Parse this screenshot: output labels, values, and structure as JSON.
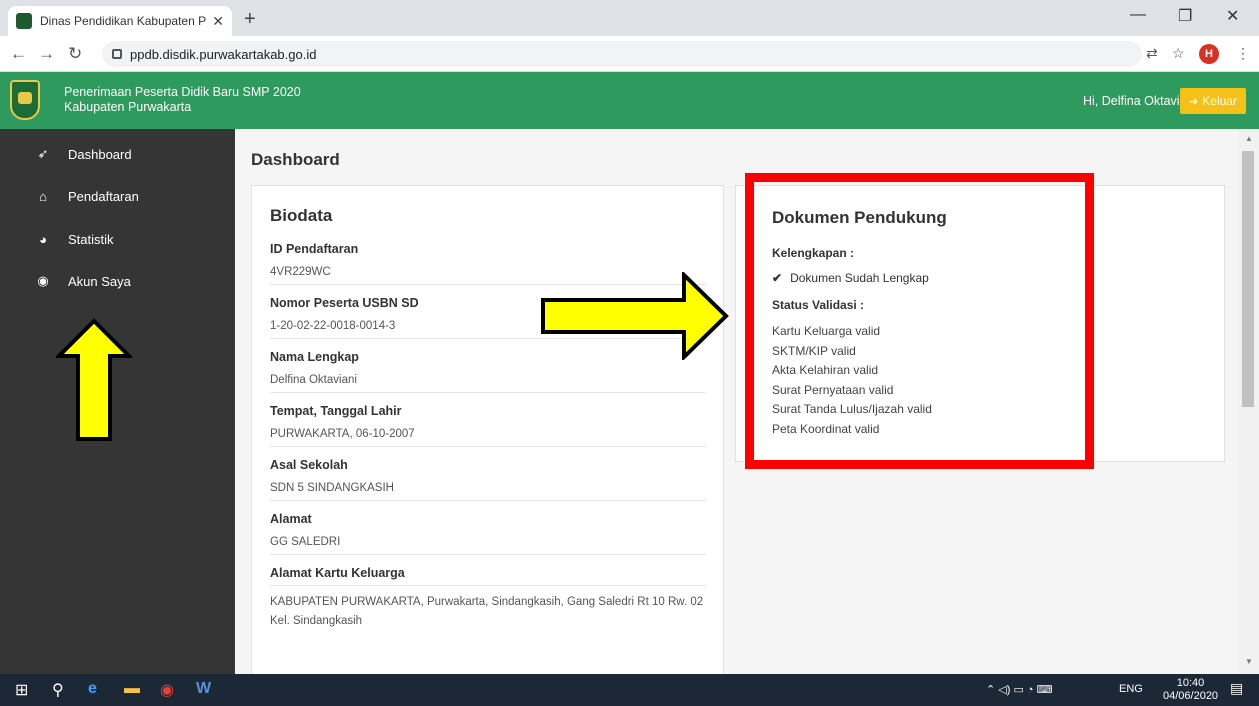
{
  "browser": {
    "tab_title": "Dinas Pendidikan Kabupaten Purw",
    "tab_close": "✕",
    "new_tab": "+",
    "url": "ppdb.disdik.purwakartakab.go.id",
    "profile_initial": "H",
    "window_controls": {
      "minimize": "—",
      "restore": "❐",
      "close": "✕"
    }
  },
  "app": {
    "title_line1": "Penerimaan Peserta Didik Baru SMP 2020",
    "title_line2": "Kabupaten Purwakarta",
    "greeting": "Hi, Delfina Oktaviani",
    "logout_label": "Keluar"
  },
  "sidebar": {
    "items": [
      {
        "label": "Dashboard",
        "icon": "rocket-icon"
      },
      {
        "label": "Pendaftaran",
        "icon": "home-icon"
      },
      {
        "label": "Statistik",
        "icon": "pie-chart-icon"
      },
      {
        "label": "Akun Saya",
        "icon": "user-circle-icon"
      }
    ]
  },
  "page": {
    "title": "Dashboard"
  },
  "biodata": {
    "heading": "Biodata",
    "fields": [
      {
        "label": "ID Pendaftaran",
        "value": "4VR229WC"
      },
      {
        "label": "Nomor Peserta USBN SD",
        "value": "1-20-02-22-0018-0014-3"
      },
      {
        "label": "Nama Lengkap",
        "value": "Delfina Oktaviani"
      },
      {
        "label": "Tempat, Tanggal Lahir",
        "value": "PURWAKARTA, 06-10-2007"
      },
      {
        "label": "Asal Sekolah",
        "value": "SDN 5 SINDANGKASIH"
      },
      {
        "label": "Alamat",
        "value": "GG SALEDRI"
      },
      {
        "label": "Alamat Kartu Keluarga",
        "value_line1": "KABUPATEN PURWAKARTA, Purwakarta, Sindangkasih, Gang Saledri Rt 10 Rw. 02",
        "value_line2": "Kel. Sindangkasih"
      }
    ]
  },
  "dokumen": {
    "heading": "Dokumen Pendukung",
    "kelengkapan_label": "Kelengkapan :",
    "kelengkapan_status": "Dokumen Sudah Lengkap",
    "validasi_label": "Status Validasi :",
    "validasi_items": [
      "Kartu Keluarga valid",
      "SKTM/KIP valid",
      "Akta Kelahiran valid",
      "Surat Pernyataan valid",
      "Surat Tanda Lulus/Ijazah valid",
      "Peta Koordinat valid"
    ]
  },
  "annotations": {
    "highlight_color": "#ff0000",
    "arrow_color": "#ffff00"
  },
  "taskbar": {
    "lang": "ENG",
    "time": "10:40",
    "date": "04/06/2020"
  },
  "colors": {
    "header_green": "#2e9a5d",
    "sidebar_dark": "#353535",
    "logout_yellow": "#f5c118"
  }
}
